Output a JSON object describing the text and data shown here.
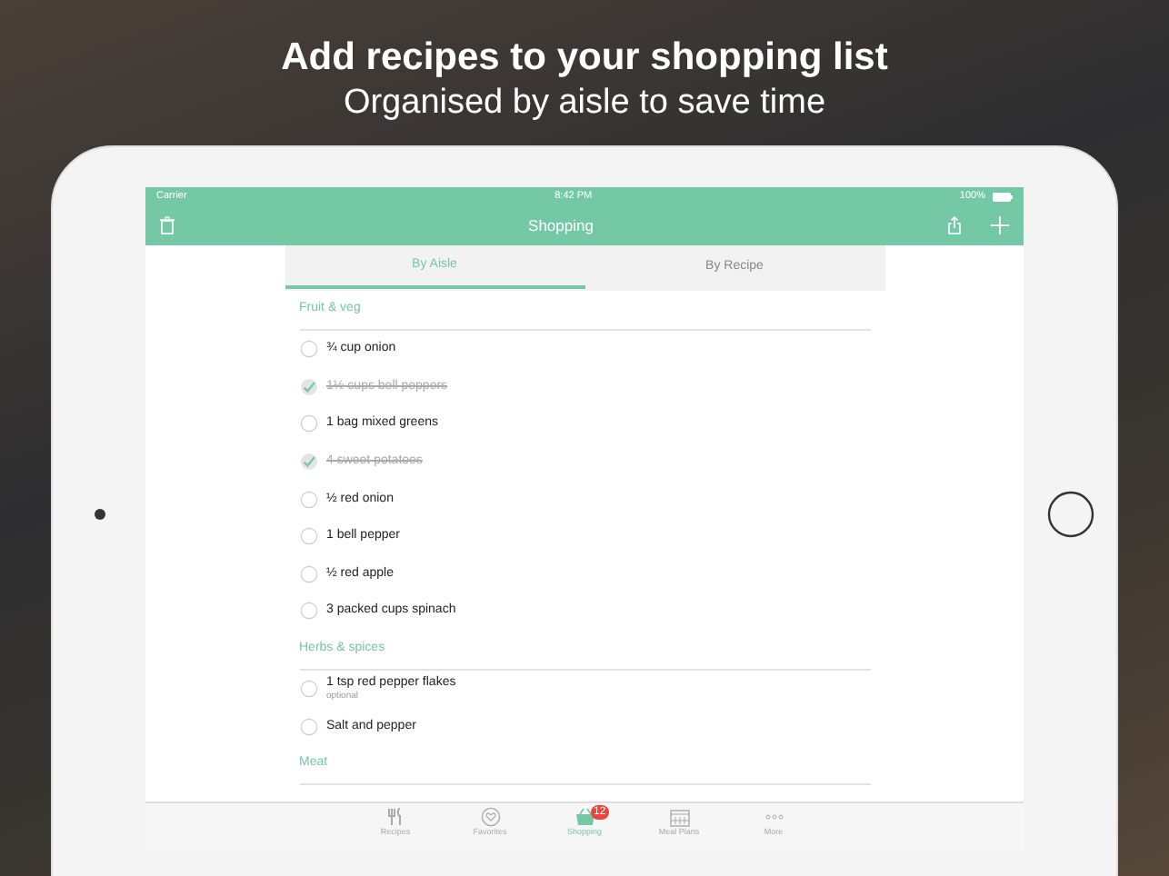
{
  "headline": {
    "title": "Add recipes to your shopping list",
    "subtitle": "Organised by aisle to save time"
  },
  "status_bar": {
    "carrier": "Carrier",
    "time": "8:42 PM",
    "battery": "100%"
  },
  "nav_bar": {
    "title": "Shopping"
  },
  "segments": [
    {
      "label": "By Aisle",
      "selected": true
    },
    {
      "label": "By Recipe",
      "selected": false
    }
  ],
  "sections": [
    {
      "title": "Fruit & veg",
      "items": [
        {
          "text": "¾ cup onion",
          "checked": false
        },
        {
          "text": "1½ cups bell peppers",
          "checked": true
        },
        {
          "text": "1 bag mixed greens",
          "checked": false
        },
        {
          "text": "4 sweet potatoes",
          "checked": true
        },
        {
          "text": "½ red onion",
          "checked": false
        },
        {
          "text": "1 bell pepper",
          "checked": false
        },
        {
          "text": "½ red apple",
          "checked": false
        },
        {
          "text": "3 packed cups spinach",
          "checked": false
        }
      ]
    },
    {
      "title": "Herbs & spices",
      "items": [
        {
          "text": "1 tsp red pepper flakes",
          "note": "optional",
          "checked": false
        },
        {
          "text": "Salt and pepper",
          "checked": false
        }
      ]
    },
    {
      "title": "Meat"
    }
  ],
  "tab_bar": [
    {
      "kind": "recipes",
      "label": "Recipes",
      "selected": false
    },
    {
      "kind": "favorites",
      "label": "Favorites",
      "selected": false
    },
    {
      "kind": "shopping",
      "label": "Shopping",
      "selected": true,
      "badge": "12"
    },
    {
      "kind": "meal_plans",
      "label": "Meal Plans",
      "selected": false
    },
    {
      "kind": "more",
      "label": "More",
      "selected": false
    }
  ]
}
